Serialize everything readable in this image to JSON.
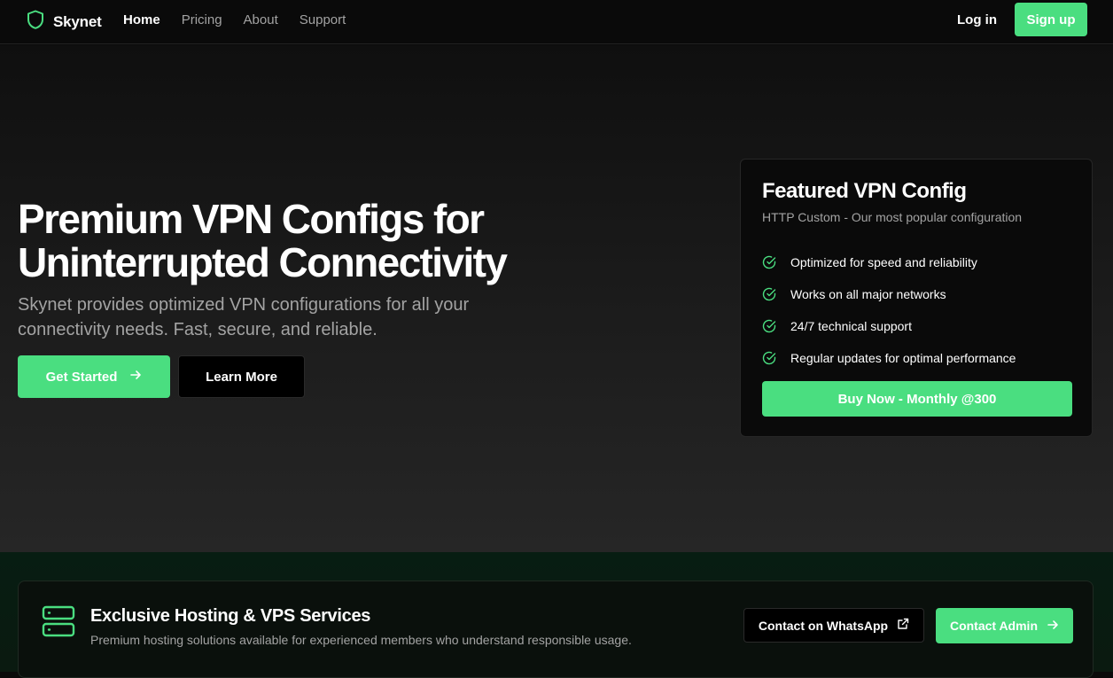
{
  "nav": {
    "brand": "Skynet",
    "links": [
      {
        "label": "Home",
        "active": true
      },
      {
        "label": "Pricing",
        "active": false
      },
      {
        "label": "About",
        "active": false
      },
      {
        "label": "Support",
        "active": false
      }
    ],
    "login_label": "Log in",
    "signup_label": "Sign up"
  },
  "hero": {
    "title_line1": "Premium VPN Configs for",
    "title_line2": "Uninterrupted Connectivity",
    "subtitle": "Skynet provides optimized VPN configurations for all your connectivity needs. Fast, secure, and reliable.",
    "primary_cta": "Get Started",
    "secondary_cta": "Learn More"
  },
  "featured": {
    "title": "Featured VPN Config",
    "subtitle": "HTTP Custom - Our most popular configuration",
    "features": [
      "Optimized for speed and reliability",
      "Works on all major networks",
      "24/7 technical support",
      "Regular updates for optimal performance"
    ],
    "buy_label": "Buy Now - Monthly @300"
  },
  "hosting": {
    "title": "Exclusive Hosting & VPS Services",
    "subtitle": "Premium hosting solutions available for experienced members who understand responsible usage.",
    "whatsapp_label": "Contact on WhatsApp",
    "admin_label": "Contact Admin"
  },
  "icons": {
    "brand": "shield-icon",
    "cta_arrow": "arrow-right-icon",
    "feature": "check-circle-icon",
    "hosting": "server-icon",
    "external": "external-link-icon"
  },
  "colors": {
    "accent": "#4ade80",
    "background": "#0a0a0a",
    "muted_text": "#a3a3a3"
  }
}
